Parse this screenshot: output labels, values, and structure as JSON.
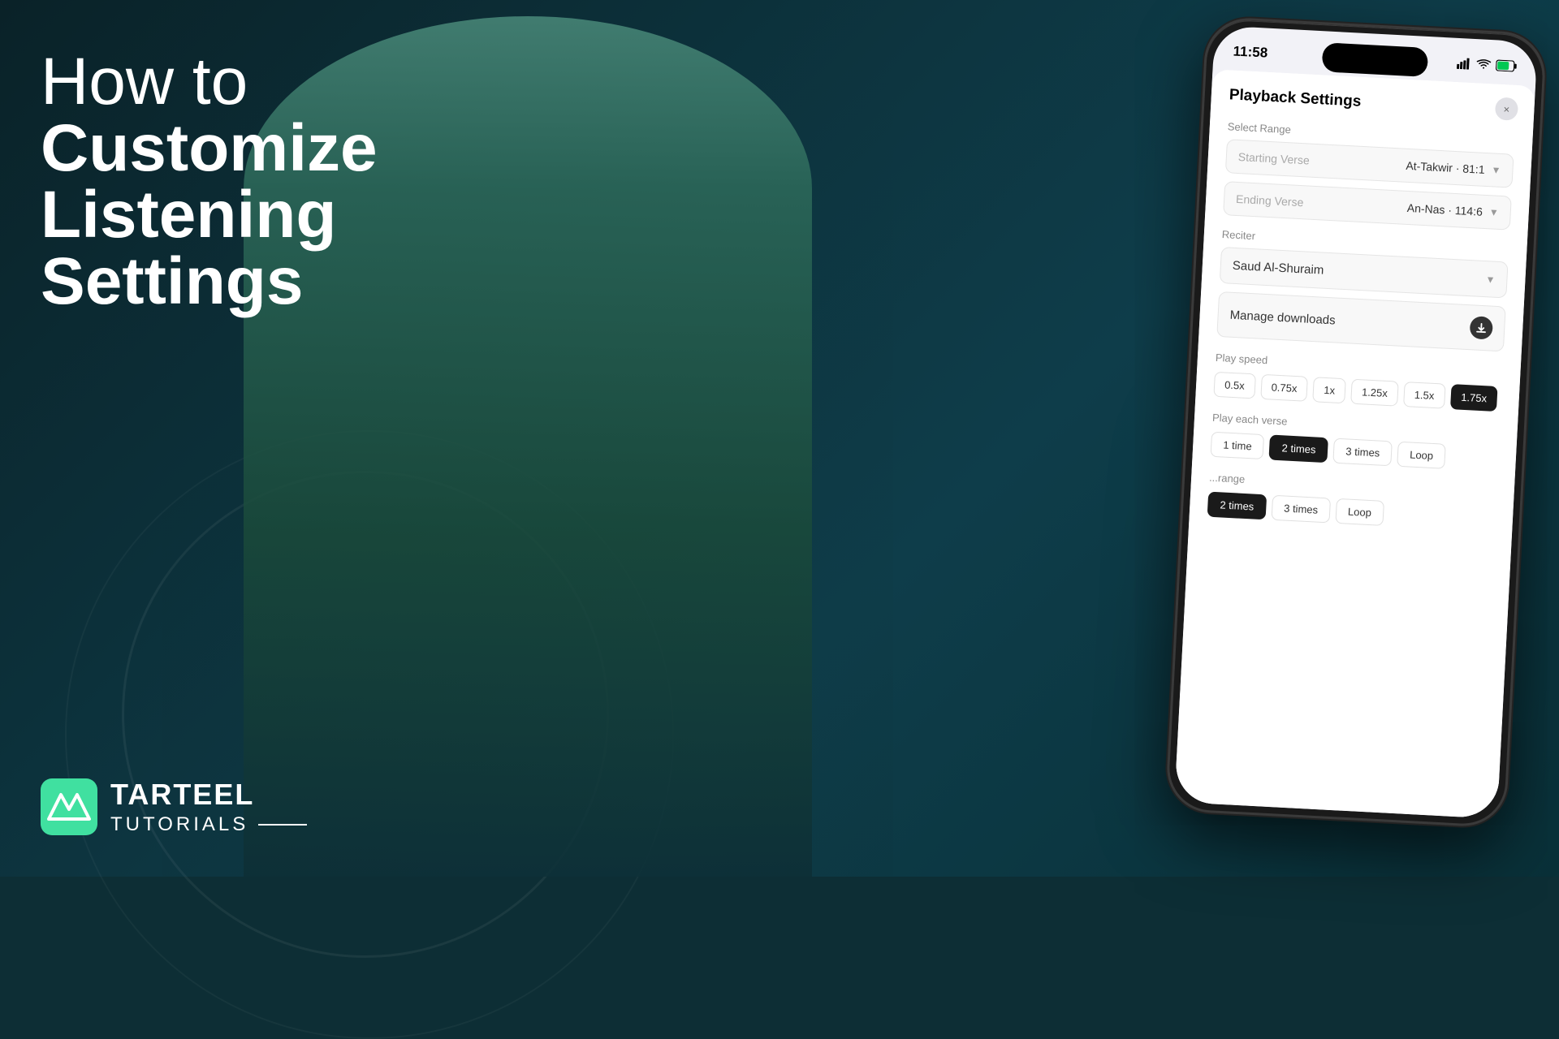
{
  "background": {
    "color": "#0d2e35"
  },
  "title": {
    "line1": "How to",
    "line2": "Customize",
    "line3": "Listening",
    "line4": "Settings"
  },
  "logo": {
    "brand": "TARTEEL",
    "subtitle": "TUTORIALS"
  },
  "phone": {
    "status_bar": {
      "time": "11:58",
      "signal_icon": "📶",
      "wifi_icon": "WiFi",
      "battery_icon": "🔋"
    },
    "screen": {
      "settings_title": "Playback Settings",
      "close_label": "×",
      "select_range_label": "Select Range",
      "starting_verse_label": "Starting Verse",
      "starting_verse_value": "At-Takwir · 81:1",
      "ending_verse_label": "Ending Verse",
      "ending_verse_value": "An-Nas · 114:6",
      "reciter_label": "Reciter",
      "reciter_value": "Saud Al-Shuraim",
      "manage_downloads_label": "Manage downloads",
      "play_speed_label": "Play speed",
      "speed_options": [
        "0.5x",
        "0.75x",
        "1x",
        "1.25x",
        "1.5x",
        "1.75x"
      ],
      "active_speed": "1.75x",
      "play_verse_label": "Play each verse",
      "verse_options": [
        "1 time",
        "2 times",
        "3 times",
        "Loop"
      ],
      "active_verse": "2 times",
      "range_label": "...range",
      "range_options": [
        "2 times",
        "3 times",
        "Loop"
      ],
      "active_range": "2 times"
    }
  }
}
